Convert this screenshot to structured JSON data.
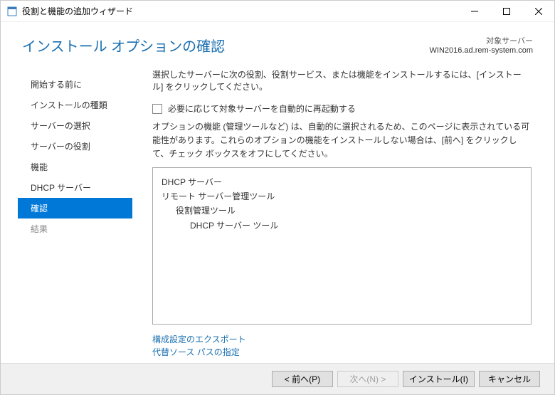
{
  "window": {
    "title": "役割と機能の追加ウィザード"
  },
  "header": {
    "page_title": "インストール オプションの確認",
    "target_label": "対象サーバー",
    "target_name": "WIN2016.ad.rem-system.com"
  },
  "sidebar": {
    "items": [
      {
        "label": "開始する前に",
        "state": "enabled"
      },
      {
        "label": "インストールの種類",
        "state": "enabled"
      },
      {
        "label": "サーバーの選択",
        "state": "enabled"
      },
      {
        "label": "サーバーの役割",
        "state": "enabled"
      },
      {
        "label": "機能",
        "state": "enabled"
      },
      {
        "label": "DHCP サーバー",
        "state": "enabled"
      },
      {
        "label": "確認",
        "state": "active"
      },
      {
        "label": "結果",
        "state": "disabled"
      }
    ]
  },
  "content": {
    "instruction": "選択したサーバーに次の役割、役割サービス、または機能をインストールするには、[インストール] をクリックしてください。",
    "checkbox_label": "必要に応じて対象サーバーを自動的に再起動する",
    "explain": "オプションの機能 (管理ツールなど) は、自動的に選択されるため、このページに表示されている可能性があります。これらのオプションの機能をインストールしない場合は、[前へ] をクリックして、チェック ボックスをオフにしてください。",
    "features": [
      {
        "label": "DHCP サーバー",
        "indent": 0
      },
      {
        "label": "リモート サーバー管理ツール",
        "indent": 0
      },
      {
        "label": "役割管理ツール",
        "indent": 1
      },
      {
        "label": "DHCP サーバー ツール",
        "indent": 2
      }
    ],
    "links": {
      "export": "構成設定のエクスポート",
      "altsource": "代替ソース パスの指定"
    }
  },
  "footer": {
    "prev": "< 前へ(P)",
    "next": "次へ(N) >",
    "install": "インストール(I)",
    "cancel": "キャンセル"
  }
}
